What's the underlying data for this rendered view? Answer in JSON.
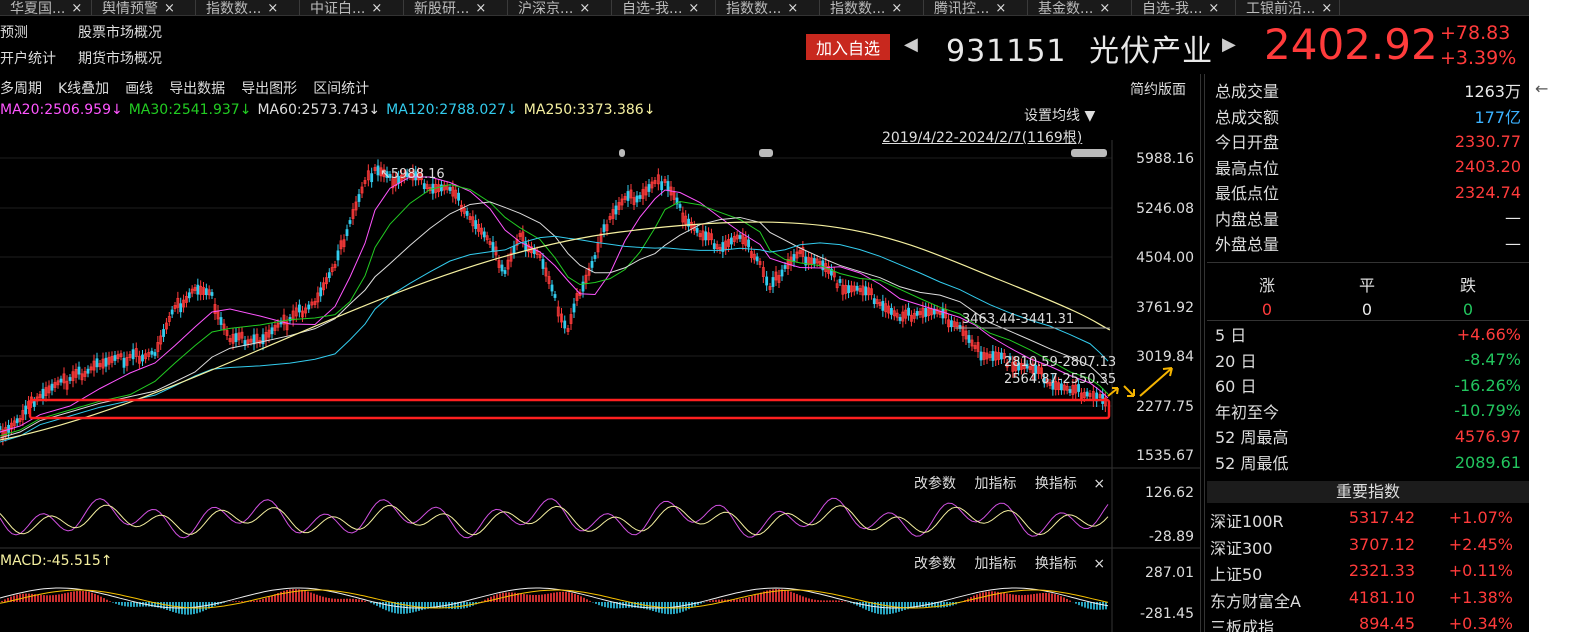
{
  "tabs": [
    {
      "label": "华夏国..."
    },
    {
      "label": "舆情预警"
    },
    {
      "label": "指数数..."
    },
    {
      "label": "中证白..."
    },
    {
      "label": "新股研..."
    },
    {
      "label": "沪深京..."
    },
    {
      "label": "自选-我..."
    },
    {
      "label": "指数数..."
    },
    {
      "label": "指数数..."
    },
    {
      "label": "腾讯控..."
    },
    {
      "label": "基金数..."
    },
    {
      "label": "自选-我..."
    },
    {
      "label": "工银前沿..."
    }
  ],
  "tab_close": "×",
  "tab_plus": "+",
  "quick_links": {
    "col1": [
      "预测",
      "开户统计"
    ],
    "col2": [
      "股票市场概况",
      "期货市场概况"
    ]
  },
  "header": {
    "add_watch": "加入自选",
    "prev": "◀",
    "next": "▶",
    "code": "931151",
    "name": "光伏产业",
    "price": "2402.92",
    "change": "+78.83",
    "change_pct": "+3.39%"
  },
  "toolbar": {
    "items": [
      "多周期",
      "K线叠加",
      "画线",
      "导出数据",
      "导出图形",
      "区间统计"
    ],
    "compact_layout": "简约版面"
  },
  "ma_legend": [
    {
      "text": "MA20:2506.959↓",
      "color": "#ff55ff"
    },
    {
      "text": "MA30:2541.937↓",
      "color": "#22cc22"
    },
    {
      "text": "MA60:2573.743↓",
      "color": "#dddddd"
    },
    {
      "text": "MA120:2788.027↓",
      "color": "#33ccee"
    },
    {
      "text": "MA250:3373.386↓",
      "color": "#f5f0a0"
    }
  ],
  "set_ma": "设置均线 ▼",
  "date_range": "2019/4/22-2024/2/7(1169根)",
  "price_axis": [
    "5988.16",
    "5246.08",
    "4504.00",
    "3761.92",
    "3019.84",
    "2277.75",
    "1535.67"
  ],
  "annotations": {
    "peak": "5988.16",
    "level1": "3463.44-3441.31",
    "level2": "2810.59-2807.13",
    "level3": "2564.87-2550.35"
  },
  "indicator_panel1": {
    "controls": [
      "改参数",
      "加指标",
      "换指标",
      "×"
    ],
    "axis": [
      "126.62",
      "-28.89"
    ]
  },
  "indicator_panel2": {
    "title": "MACD:-45.515↑",
    "controls": [
      "改参数",
      "加指标",
      "换指标",
      "×"
    ],
    "axis": [
      "287.01",
      "-281.45"
    ]
  },
  "stats": [
    {
      "label": "总成交量",
      "value": "1263万",
      "cls": "white"
    },
    {
      "label": "总成交额",
      "value": "177亿",
      "cls": "blue"
    },
    {
      "label": "今日开盘",
      "value": "2330.77",
      "cls": "red"
    },
    {
      "label": "最高点位",
      "value": "2403.20",
      "cls": "red"
    },
    {
      "label": "最低点位",
      "value": "2324.74",
      "cls": "red"
    },
    {
      "label": "内盘总量",
      "value": "—",
      "cls": "white"
    },
    {
      "label": "外盘总量",
      "value": "—",
      "cls": "white"
    }
  ],
  "breadth": [
    {
      "label": "涨",
      "value": "0",
      "cls": "red"
    },
    {
      "label": "平",
      "value": "0",
      "cls": "white"
    },
    {
      "label": "跌",
      "value": "0",
      "cls": "green"
    }
  ],
  "periods": [
    {
      "label": "5 日",
      "value": "+4.66%",
      "cls": "red"
    },
    {
      "label": "20 日",
      "value": "-8.47%",
      "cls": "green"
    },
    {
      "label": "60 日",
      "value": "-16.26%",
      "cls": "green"
    },
    {
      "label": "年初至今",
      "value": "-10.79%",
      "cls": "green"
    },
    {
      "label": "52 周最高",
      "value": "4576.97",
      "cls": "red"
    },
    {
      "label": "52 周最低",
      "value": "2089.61",
      "cls": "green"
    }
  ],
  "key_index_title": "重要指数",
  "key_indices": [
    {
      "name": "深证100R",
      "price": "5317.42",
      "chg": "+1.07%"
    },
    {
      "name": "深证300",
      "price": "3707.12",
      "chg": "+2.45%"
    },
    {
      "name": "上证50",
      "price": "2321.33",
      "chg": "+0.11%"
    },
    {
      "name": "东方财富全A",
      "price": "4181.10",
      "chg": "+1.38%"
    },
    {
      "name": "三板成指",
      "price": "894.45",
      "chg": "+0.34%"
    }
  ],
  "edge_arrow": "←"
}
